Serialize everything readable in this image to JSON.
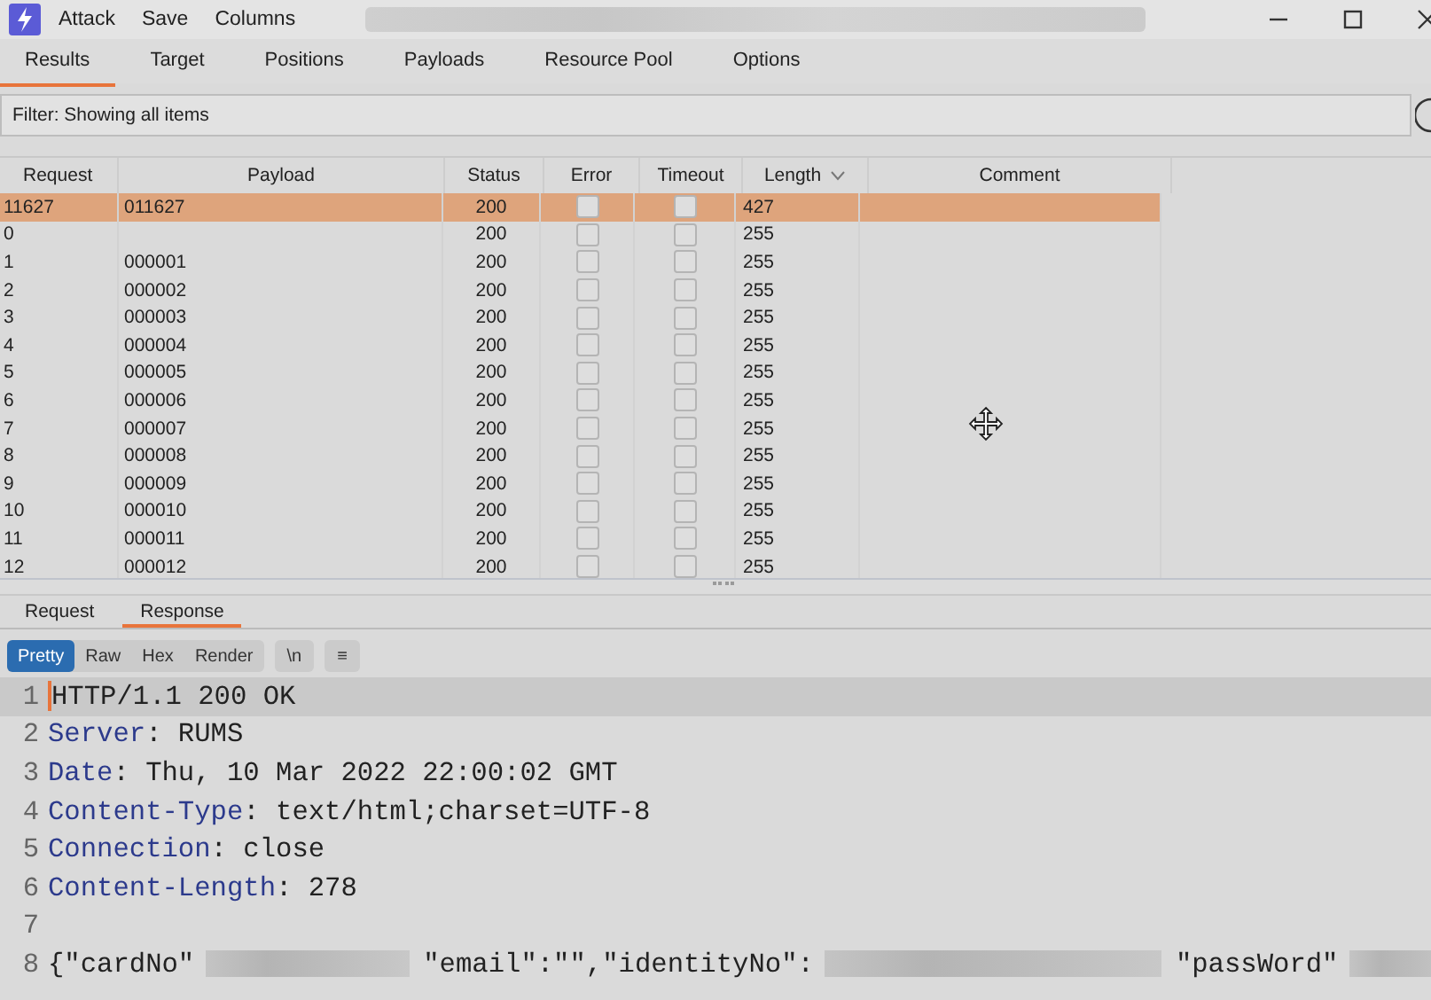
{
  "menu": [
    "Attack",
    "Save",
    "Columns"
  ],
  "tabs": [
    {
      "label": "Results",
      "selected": true
    },
    {
      "label": "Target",
      "selected": false
    },
    {
      "label": "Positions",
      "selected": false
    },
    {
      "label": "Payloads",
      "selected": false
    },
    {
      "label": "Resource Pool",
      "selected": false
    },
    {
      "label": "Options",
      "selected": false
    }
  ],
  "filter": {
    "label": "Filter: Showing all items"
  },
  "table": {
    "columns": [
      {
        "label": "Request",
        "sorted": false
      },
      {
        "label": "Payload",
        "sorted": false
      },
      {
        "label": "Status",
        "sorted": false
      },
      {
        "label": "Error",
        "sorted": false
      },
      {
        "label": "Timeout",
        "sorted": false
      },
      {
        "label": "Length",
        "sorted": true
      },
      {
        "label": "Comment",
        "sorted": false
      }
    ],
    "rows": [
      {
        "request": "11627",
        "payload": "011627",
        "status": "200",
        "error": false,
        "timeout": false,
        "length": "427",
        "selected": true
      },
      {
        "request": "0",
        "status": "200",
        "error": false,
        "timeout": false,
        "length": "255",
        "selected": false
      },
      {
        "request": "1",
        "payload": "000001",
        "status": "200",
        "error": false,
        "timeout": false,
        "length": "255",
        "selected": false
      },
      {
        "request": "2",
        "payload": "000002",
        "status": "200",
        "error": false,
        "timeout": false,
        "length": "255",
        "selected": false
      },
      {
        "request": "3",
        "payload": "000003",
        "status": "200",
        "error": false,
        "timeout": false,
        "length": "255",
        "selected": false
      },
      {
        "request": "4",
        "payload": "000004",
        "status": "200",
        "error": false,
        "timeout": false,
        "length": "255",
        "selected": false
      },
      {
        "request": "5",
        "payload": "000005",
        "status": "200",
        "error": false,
        "timeout": false,
        "length": "255",
        "selected": false
      },
      {
        "request": "6",
        "payload": "000006",
        "status": "200",
        "error": false,
        "timeout": false,
        "length": "255",
        "selected": false
      },
      {
        "request": "7",
        "payload": "000007",
        "status": "200",
        "error": false,
        "timeout": false,
        "length": "255",
        "selected": false
      },
      {
        "request": "8",
        "payload": "000008",
        "status": "200",
        "error": false,
        "timeout": false,
        "length": "255",
        "selected": false
      },
      {
        "request": "9",
        "payload": "000009",
        "status": "200",
        "error": false,
        "timeout": false,
        "length": "255",
        "selected": false
      },
      {
        "request": "10",
        "payload": "000010",
        "status": "200",
        "error": false,
        "timeout": false,
        "length": "255",
        "selected": false
      },
      {
        "request": "11",
        "payload": "000011",
        "status": "200",
        "error": false,
        "timeout": false,
        "length": "255",
        "selected": false
      },
      {
        "request": "12",
        "payload": "000012",
        "status": "200",
        "error": false,
        "timeout": false,
        "length": "255",
        "selected": false
      }
    ]
  },
  "message_tabs": [
    {
      "label": "Request",
      "selected": false
    },
    {
      "label": "Response",
      "selected": true
    }
  ],
  "view_buttons": [
    {
      "label": "Pretty",
      "selected": true
    },
    {
      "label": "Raw",
      "selected": false
    },
    {
      "label": "Hex",
      "selected": false
    },
    {
      "label": "Render",
      "selected": false
    }
  ],
  "toggle_buttons": [
    "\\n",
    "≡"
  ],
  "lines": [
    {
      "number": "1",
      "current": true,
      "parts": [
        {
          "kind": "plain",
          "text": "HTTP/1.1 200 OK"
        }
      ]
    },
    {
      "number": "2",
      "current": false,
      "parts": [
        {
          "kind": "key",
          "text": "Server"
        },
        {
          "kind": "plain",
          "text": ": RUMS"
        }
      ]
    },
    {
      "number": "3",
      "current": false,
      "parts": [
        {
          "kind": "key",
          "text": "Date"
        },
        {
          "kind": "plain",
          "text": ": Thu, 10 Mar 2022 22:00:02 GMT"
        }
      ]
    },
    {
      "number": "4",
      "current": false,
      "parts": [
        {
          "kind": "key",
          "text": "Content-Type"
        },
        {
          "kind": "plain",
          "text": ": text/html;charset=UTF-8"
        }
      ]
    },
    {
      "number": "5",
      "current": false,
      "parts": [
        {
          "kind": "key",
          "text": "Connection"
        },
        {
          "kind": "plain",
          "text": ": close"
        }
      ]
    },
    {
      "number": "6",
      "current": false,
      "parts": [
        {
          "kind": "key",
          "text": "Content-Length"
        },
        {
          "kind": "plain",
          "text": ": 278"
        }
      ]
    },
    {
      "number": "7",
      "current": false
    },
    {
      "number": "8",
      "current": false,
      "parts": [
        {
          "kind": "plain",
          "text": "{\"cardNo\""
        },
        {
          "kind": "redacted-medium"
        },
        {
          "kind": "plain",
          "text": "\"email\":\"\",\"identityNo\":"
        },
        {
          "kind": "redacted-long"
        },
        {
          "kind": "plain",
          "text": "\"passWord\""
        },
        {
          "kind": "redacted-tail"
        }
      ]
    }
  ]
}
